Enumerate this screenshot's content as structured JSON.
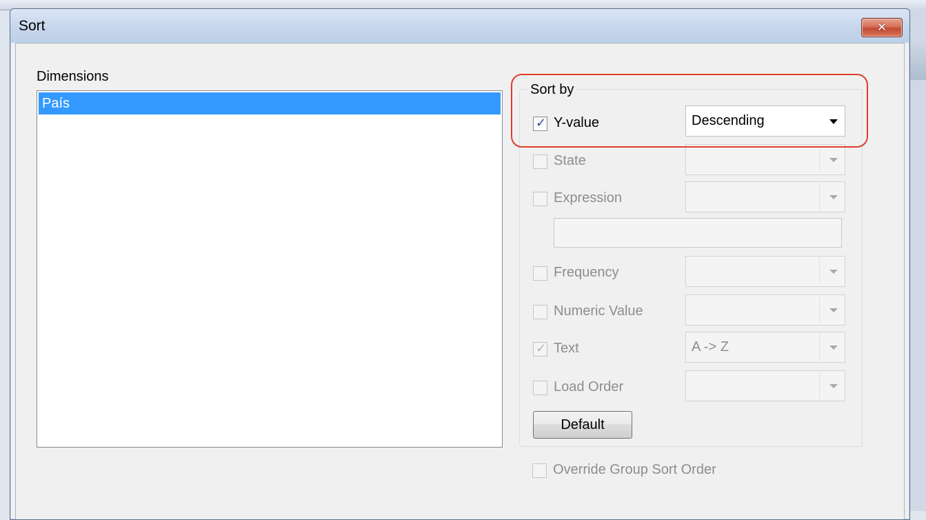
{
  "window": {
    "title": "Sort",
    "close_glyph": "✕"
  },
  "dimensions": {
    "label": "Dimensions",
    "items": [
      "País"
    ]
  },
  "sort_by": {
    "title": "Sort by",
    "options": [
      {
        "label": "Y-value",
        "checked": true,
        "enabled": true,
        "combo": "Descending"
      },
      {
        "label": "State",
        "checked": false,
        "enabled": false,
        "combo": ""
      },
      {
        "label": "Expression",
        "checked": false,
        "enabled": false,
        "combo": ""
      },
      {
        "label": "Frequency",
        "checked": false,
        "enabled": false,
        "combo": ""
      },
      {
        "label": "Numeric Value",
        "checked": false,
        "enabled": false,
        "combo": ""
      },
      {
        "label": "Text",
        "checked": true,
        "enabled": false,
        "combo": "A -> Z"
      },
      {
        "label": "Load Order",
        "checked": false,
        "enabled": false,
        "combo": ""
      }
    ],
    "expression_text": "",
    "default_button": "Default"
  },
  "override": {
    "label": "Override Group Sort Order",
    "checked": false,
    "enabled": false
  },
  "colors": {
    "selection": "#3399ff",
    "highlight_outline": "#e03c2c",
    "check_mark": "#2b4f8e"
  },
  "icons": {
    "check": "check-mark-icon",
    "dropdown": "dropdown-arrow-icon",
    "close": "close-icon"
  }
}
